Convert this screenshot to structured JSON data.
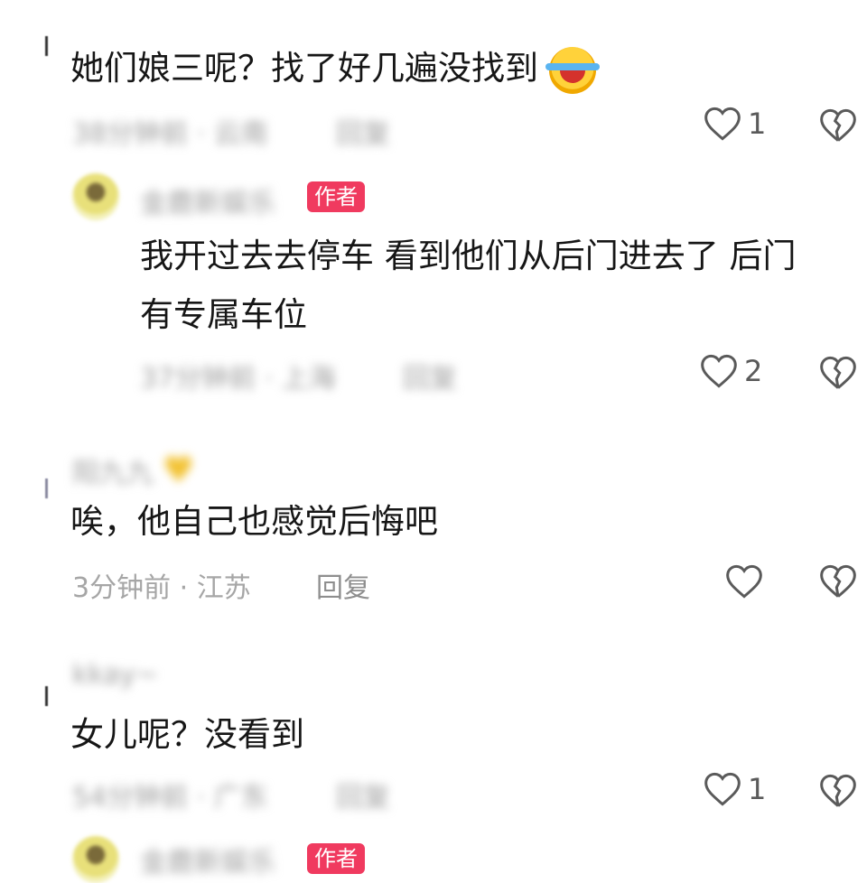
{
  "comments": [
    {
      "text": "她们娘三呢？找了好几遍没找到",
      "meta_blurred": "38分钟前 · 云南",
      "reply_blurred": "回复",
      "likes": "1",
      "reply": {
        "username_blurred": "金鹿新娱乐",
        "badge": "作者",
        "text_line1": "我开过去去停车 看到他们从后门进去了 后门",
        "text_line2": "有专属车位",
        "meta_blurred": "37分钟前 · 上海",
        "reply_blurred": "回复",
        "likes": "2"
      }
    },
    {
      "username_blurred": "阳九九",
      "text": "唉，他自己也感觉后悔吧",
      "meta": "3分钟前 · 江苏",
      "reply_label": "回复",
      "likes": ""
    },
    {
      "username_blurred": "kkay~",
      "text": "女儿呢？没看到",
      "meta_blurred": "54分钟前 · 广东",
      "reply_blurred": "回复",
      "likes": "1",
      "reply": {
        "username_blurred": "金鹿新娱乐",
        "badge": "作者"
      }
    }
  ]
}
